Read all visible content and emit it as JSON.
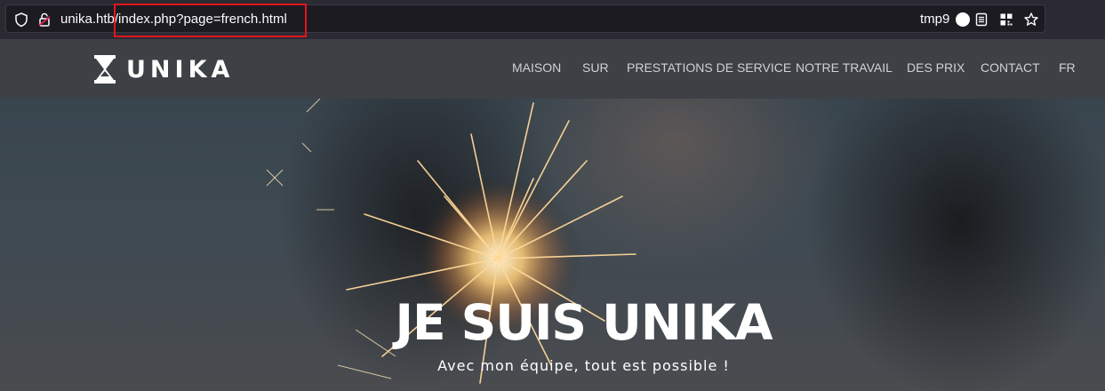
{
  "browser": {
    "url_host": "unika.htb",
    "url_path": "/index.php?page=french.html",
    "container_label": "tmp9"
  },
  "site": {
    "logo_text": "UNIKA",
    "nav": [
      {
        "label": "MAISON"
      },
      {
        "label": "SUR"
      },
      {
        "label": "PRESTATIONS DE SERVICE"
      },
      {
        "label": "NOTRE TRAVAIL"
      },
      {
        "label": "DES PRIX"
      },
      {
        "label": "CONTACT"
      },
      {
        "label": "FR"
      }
    ]
  },
  "hero": {
    "title": "JE SUIS UNIKA",
    "subtitle": "Avec mon équipe, tout est possible !"
  },
  "colors": {
    "highlight": "#e0161d",
    "navbar_bg": "#3d4045",
    "toolbar_bg": "#2b2a33"
  },
  "icons": [
    "shield-icon",
    "lock-broken-icon",
    "reader-view-icon",
    "extension-icon",
    "bookmark-star-icon",
    "hourglass-logo-icon"
  ]
}
